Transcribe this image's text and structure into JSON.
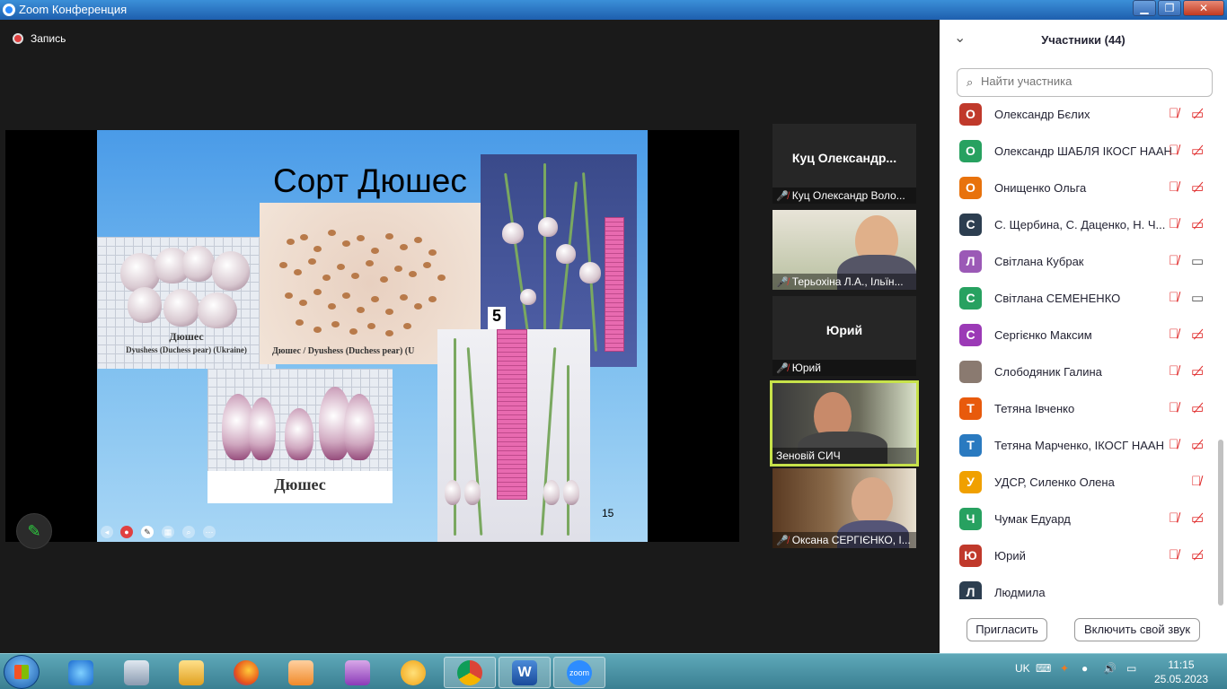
{
  "window": {
    "title": "Zoom Конференция",
    "minimize": "▁",
    "restore": "❐",
    "close": "✕"
  },
  "recording": {
    "label": "Запись"
  },
  "slide": {
    "title": "Сорт Дюшес",
    "caption_top_left": "Дюшес",
    "caption_top_left_sub": "Dyushess (Duchess pear) (Ukraine)",
    "caption_seeds": "Дюшес / Dyushess (Duchess pear) (U",
    "caption_bottom": "Дюшес",
    "ruler_number": "5",
    "page_number": "15"
  },
  "video_tiles": [
    {
      "big_name": "Куц  Олександр...",
      "label": "Куц Олександр Воло..."
    },
    {
      "label": "Терьохіна Л.А., Ільїн..."
    },
    {
      "big_name": "Юрий",
      "label": "Юрий"
    },
    {
      "label": "Зеновій СИЧ"
    },
    {
      "label": "Оксана СЕРГІЄНКО, І..."
    }
  ],
  "panel": {
    "title": "Участники (44)",
    "search_placeholder": "Найти участника",
    "participants": [
      {
        "initial": "О",
        "name": "Олександр Бєлих",
        "color": "#c0392b"
      },
      {
        "initial": "О",
        "name": "Олександр ШАБЛЯ ІКОСГ НААН",
        "color": "#27a160"
      },
      {
        "initial": "О",
        "name": "Онищенко Ольга",
        "color": "#e8720c"
      },
      {
        "initial": "С",
        "name": "С. Щербина, С. Даценко, Н. Ч...",
        "color": "#2c3e50"
      },
      {
        "initial": "Л",
        "name": "Світлана Кубрак",
        "color": "#9b59b6"
      },
      {
        "initial": "С",
        "name": "Світлана СЕМЕНЕНКО",
        "color": "#27a160"
      },
      {
        "initial": "С",
        "name": "Сергієнко Максим",
        "color": "#9b3ab6"
      },
      {
        "initial": "",
        "name": "Слободяник Галина",
        "color": "#8a7a70"
      },
      {
        "initial": "Т",
        "name": "Тетяна Івченко",
        "color": "#e85a0c"
      },
      {
        "initial": "Т",
        "name": "Тетяна Марченко, ІКОСГ НААН",
        "color": "#2a7ac0"
      },
      {
        "initial": "У",
        "name": "УДСР, Силенко Олена",
        "color": "#f0a000"
      },
      {
        "initial": "Ч",
        "name": "Чумак Едуард",
        "color": "#27a160"
      },
      {
        "initial": "Ю",
        "name": "Юрий",
        "color": "#c0392b"
      },
      {
        "initial": "Л",
        "name": "Людмила",
        "color": "#2c3e50"
      }
    ],
    "invite_button": "Пригласить",
    "unmute_button": "Включить свой звук"
  },
  "taskbar": {
    "lang": "UK",
    "time": "11:15",
    "date": "25.05.2023",
    "zoom_label": "zoom"
  }
}
